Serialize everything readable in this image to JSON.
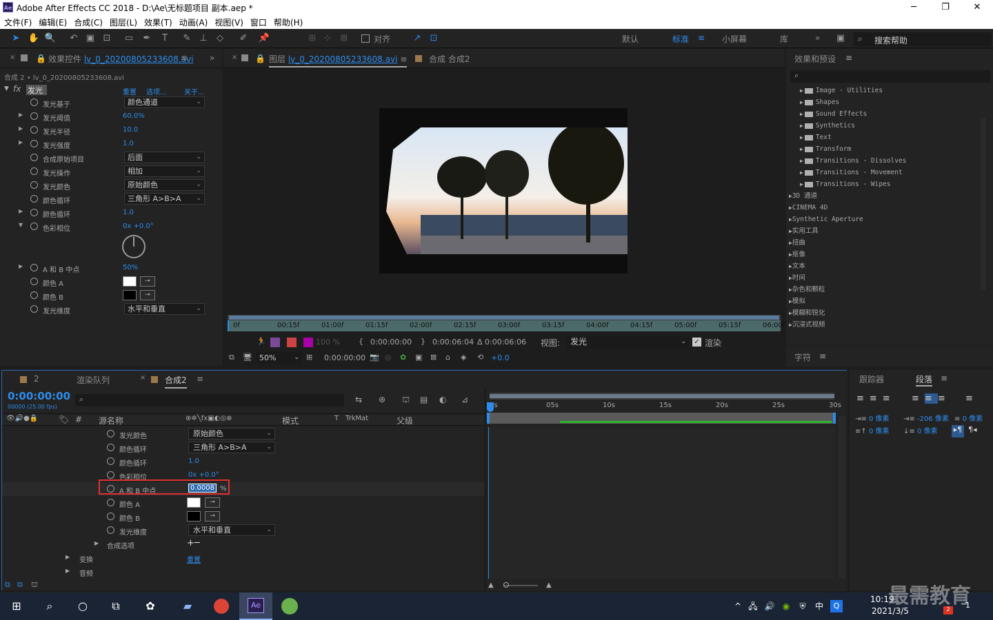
{
  "window": {
    "title": "Adobe After Effects CC 2018 - D:\\Ae\\无标题项目 副本.aep *",
    "logo": "Ae",
    "min": "─",
    "restore": "❐",
    "close": "✕"
  },
  "menu": [
    "文件(F)",
    "编辑(E)",
    "合成(C)",
    "图层(L)",
    "效果(T)",
    "动画(A)",
    "视图(V)",
    "窗口",
    "帮助(H)"
  ],
  "toolbar": {
    "align": "对齐",
    "workspaces": [
      "默认",
      "标准",
      "小屏幕",
      "库"
    ],
    "active_workspace": "标准",
    "search_help": "搜索帮助",
    "more": "»"
  },
  "effect_controls": {
    "tab": "效果控件",
    "tab_file": "lv_0_20200805233608.avi",
    "breadcrumb": "合成 2 • lv_0_20200805233608.avi",
    "effect_name": "发光",
    "links": [
      "重置",
      "选项...",
      "关于..."
    ],
    "props": [
      {
        "label": "发光基于",
        "dropdown": "颜色通道"
      },
      {
        "label": "发光阈值",
        "value": "60.0%",
        "twirl": true
      },
      {
        "label": "发光半径",
        "value": "10.0",
        "twirl": true
      },
      {
        "label": "发光强度",
        "value": "1.0",
        "twirl": true
      },
      {
        "label": "合成原始项目",
        "dropdown": "后面"
      },
      {
        "label": "发光操作",
        "dropdown": "相加"
      },
      {
        "label": "发光颜色",
        "dropdown": "原始颜色"
      },
      {
        "label": "颜色循环",
        "dropdown": "三角形 A>B>A"
      },
      {
        "label": "颜色循环",
        "value": "1.0",
        "twirl": true
      },
      {
        "label": "色彩相位",
        "value": "0x +0.0°",
        "twirl": true,
        "open": true
      }
    ],
    "props2": [
      {
        "label": "A 和 B 中点",
        "value": "50%",
        "twirl": true
      },
      {
        "label": "颜色 A",
        "swatch": "#ffffff"
      },
      {
        "label": "颜色 B",
        "swatch": "#000000"
      },
      {
        "label": "发光维度",
        "dropdown": "水平和垂直"
      }
    ]
  },
  "viewer": {
    "tab_layer": "图层",
    "tab_layer_file": "lv_0_20200805233608.avi",
    "tab_comp": "合成 合成2",
    "ruler": [
      "0f",
      "00:15f",
      "01:00f",
      "01:15f",
      "02:00f",
      "02:15f",
      "03:00f",
      "03:15f",
      "04:00f",
      "04:15f",
      "05:00f",
      "05:15f",
      "06:00f"
    ],
    "time_in": "0:00:00:00",
    "time_out": "0:00:06:04",
    "duration": "Δ 0:00:06:06",
    "view_label": "视图:",
    "view_value": "发光",
    "render_label": "渲染",
    "opacity": "100 %",
    "zoom": "50%",
    "current_time": "0:00:00:00",
    "exposure": "+0.0"
  },
  "effects_presets": {
    "title": "效果和预设",
    "items": [
      {
        "label": "Image - Utilities",
        "folder": true
      },
      {
        "label": "Shapes",
        "folder": true
      },
      {
        "label": "Sound Effects",
        "folder": true
      },
      {
        "label": "Synthetics",
        "folder": true
      },
      {
        "label": "Text",
        "folder": true
      },
      {
        "label": "Transform",
        "folder": true
      },
      {
        "label": "Transitions - Dissolves",
        "folder": true
      },
      {
        "label": "Transitions - Movement",
        "folder": true
      },
      {
        "label": "Transitions - Wipes",
        "folder": true
      },
      {
        "label": "3D 通道",
        "folder": false
      },
      {
        "label": "CINEMA 4D",
        "folder": false
      },
      {
        "label": "Synthetic Aperture",
        "folder": false
      },
      {
        "label": "实用工具",
        "folder": false
      },
      {
        "label": "扭曲",
        "folder": false
      },
      {
        "label": "抠像",
        "folder": false
      },
      {
        "label": "文本",
        "folder": false
      },
      {
        "label": "时间",
        "folder": false
      },
      {
        "label": "杂色和颗粒",
        "folder": false
      },
      {
        "label": "模拟",
        "folder": false
      },
      {
        "label": "模糊和锐化",
        "folder": false
      },
      {
        "label": "沉浸式视频",
        "folder": false
      }
    ],
    "character_tab": "字符"
  },
  "timeline": {
    "tabs": [
      "2",
      "渲染队列",
      "合成2"
    ],
    "timecode": "0:00:00:00",
    "fps": "00000 (25.00 fps)",
    "columns": {
      "source": "源名称",
      "mode": "模式",
      "t": "T",
      "trkmat": "TrkMat",
      "parent": "父级"
    },
    "ruler": [
      "0s",
      "05s",
      "10s",
      "15s",
      "20s",
      "25s",
      "30s"
    ],
    "rows": [
      {
        "label": "发光颜色",
        "dropdown": "原始颜色"
      },
      {
        "label": "颜色循环",
        "dropdown": "三角形 A>B>A"
      },
      {
        "label": "颜色循环",
        "value": "1.0"
      },
      {
        "label": "色彩相位",
        "value": "0x +0.0°"
      },
      {
        "label": "A 和 B 中点",
        "editing": "0.0008",
        "unit": "%"
      },
      {
        "label": "颜色 A",
        "swatch": "#ffffff"
      },
      {
        "label": "颜色 B",
        "swatch": "#000000"
      },
      {
        "label": "发光维度",
        "dropdown": "水平和垂直"
      }
    ],
    "composite_options": "合成选项",
    "transform": "变换",
    "transform_reset": "重置",
    "audio": "音频"
  },
  "paragraph": {
    "tabs": [
      "跟踪器",
      "段落"
    ],
    "indent1": "0 像素",
    "indent2": "-206 像素",
    "indent3": "0 像素",
    "space1": "0 像素",
    "space2": "0 像素"
  },
  "taskbar": {
    "time": "10:19",
    "date": "2021/3/5",
    "ime": "中",
    "watermark": "最需教育",
    "notif": "1",
    "badge": "2"
  }
}
